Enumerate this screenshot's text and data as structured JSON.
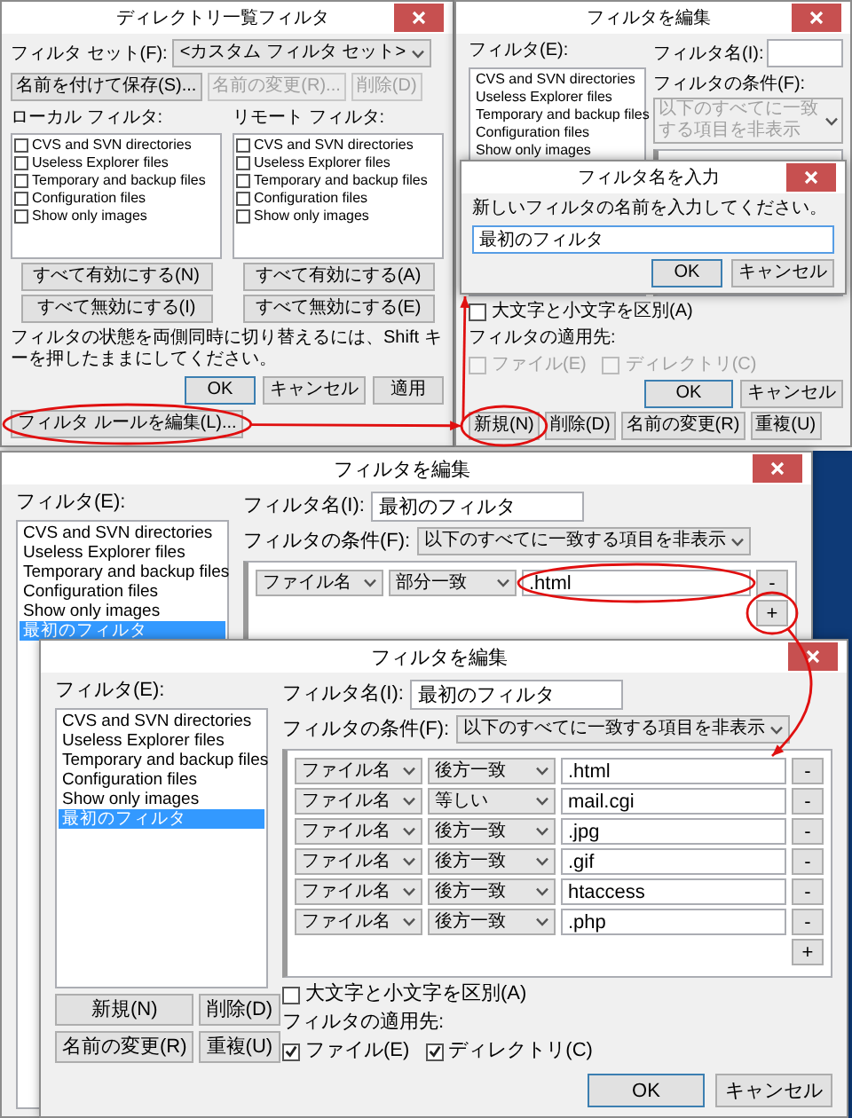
{
  "directory_filter_window": {
    "title": "ディレクトリ一覧フィルタ",
    "filter_set_label": "フィルタ セット(F):",
    "filter_set_value": "<カスタム フィルタ セット>",
    "set_buttons": [
      {
        "label": "名前を付けて保存(S)...",
        "disabled": false
      },
      {
        "label": "名前の変更(R)...",
        "disabled": true
      },
      {
        "label": "削除(D)",
        "disabled": true
      }
    ],
    "panes": [
      {
        "label": "ローカル フィルタ:",
        "items": [
          {
            "label": "CVS and SVN directories",
            "checked": false
          },
          {
            "label": "Useless Explorer files",
            "checked": false
          },
          {
            "label": "Temporary and backup files",
            "checked": false
          },
          {
            "label": "Configuration files",
            "checked": false
          },
          {
            "label": "Show only images",
            "checked": false
          }
        ],
        "buttons": [
          "すべて有効にする(N)",
          "すべて無効にする(I)"
        ]
      },
      {
        "label": "リモート フィルタ:",
        "items": [
          {
            "label": "CVS and SVN directories",
            "checked": false
          },
          {
            "label": "Useless Explorer files",
            "checked": false
          },
          {
            "label": "Temporary and backup files",
            "checked": false
          },
          {
            "label": "Configuration files",
            "checked": false
          },
          {
            "label": "Show only images",
            "checked": false
          }
        ],
        "buttons": [
          "すべて有効にする(A)",
          "すべて無効にする(E)"
        ]
      }
    ],
    "hint": "フィルタの状態を両側同時に切り替えるには、Shift キーを押したままにしてください。",
    "edit_rules_button": "フィルタ ルールを編集(L)...",
    "buttons": [
      "OK",
      "キャンセル",
      "適用"
    ]
  },
  "edit_filter_window_back": {
    "title": "フィルタを編集",
    "filters_label": "フィルタ(E):",
    "filters": [
      {
        "label": "CVS and SVN directories",
        "selected": false
      },
      {
        "label": "Useless Explorer files",
        "selected": false
      },
      {
        "label": "Temporary and backup files",
        "selected": false
      },
      {
        "label": "Configuration files",
        "selected": false
      },
      {
        "label": "Show only images",
        "selected": false
      }
    ],
    "name_label": "フィルタ名(I):",
    "condition_label": "フィルタの条件(F):",
    "condition_value": "以下のすべてに一致する項目を非表示",
    "condition_disabled": true,
    "list_buttons": [
      "新規(N)",
      "削除(D)",
      "名前の変更(R)",
      "重複(U)"
    ],
    "case_label": "大文字と小文字を区別(A)",
    "case_checked": false,
    "apply_label": "フィルタの適用先:",
    "apply_targets": [
      {
        "label": "ファイル(E)",
        "checked": false,
        "disabled": true
      },
      {
        "label": "ディレクトリ(C)",
        "checked": false,
        "disabled": true
      }
    ],
    "buttons": [
      "OK",
      "キャンセル"
    ]
  },
  "name_prompt": {
    "title": "フィルタ名を入力",
    "message": "新しいフィルタの名前を入力してください。",
    "value": "最初のフィルタ",
    "buttons": [
      "OK",
      "キャンセル"
    ]
  },
  "edit_filter_window_middle": {
    "title": "フィルタを編集",
    "filters_label": "フィルタ(E):",
    "filters": [
      {
        "label": "CVS and SVN directories",
        "selected": false
      },
      {
        "label": "Useless Explorer files",
        "selected": false
      },
      {
        "label": "Temporary and backup files",
        "selected": false
      },
      {
        "label": "Configuration files",
        "selected": false
      },
      {
        "label": "Show only images",
        "selected": false
      },
      {
        "label": "最初のフィルタ",
        "selected": true
      }
    ],
    "name_label": "フィルタ名(I):",
    "name_value": "最初のフィルタ",
    "condition_label": "フィルタの条件(F):",
    "condition_value": "以下のすべてに一致する項目を非表示",
    "condition_disabled": false,
    "rules": [
      {
        "field": "ファイル名",
        "match": "部分一致",
        "value": ".html",
        "remove": "-"
      }
    ],
    "add": "+"
  },
  "edit_filter_window_front": {
    "title": "フィルタを編集",
    "filters_label": "フィルタ(E):",
    "filters": [
      {
        "label": "CVS and SVN directories",
        "selected": false
      },
      {
        "label": "Useless Explorer files",
        "selected": false
      },
      {
        "label": "Temporary and backup files",
        "selected": false
      },
      {
        "label": "Configuration files",
        "selected": false
      },
      {
        "label": "Show only images",
        "selected": false
      },
      {
        "label": "最初のフィルタ",
        "selected": true
      }
    ],
    "name_label": "フィルタ名(I):",
    "name_value": "最初のフィルタ",
    "condition_label": "フィルタの条件(F):",
    "condition_value": "以下のすべてに一致する項目を非表示",
    "condition_disabled": false,
    "rules": [
      {
        "field": "ファイル名",
        "match": "後方一致",
        "value": ".html",
        "remove": "-"
      },
      {
        "field": "ファイル名",
        "match": "等しい",
        "value": "mail.cgi",
        "remove": "-"
      },
      {
        "field": "ファイル名",
        "match": "後方一致",
        "value": ".jpg",
        "remove": "-"
      },
      {
        "field": "ファイル名",
        "match": "後方一致",
        "value": ".gif",
        "remove": "-"
      },
      {
        "field": "ファイル名",
        "match": "後方一致",
        "value": "htaccess",
        "remove": "-"
      },
      {
        "field": "ファイル名",
        "match": "後方一致",
        "value": ".php",
        "remove": "-"
      }
    ],
    "add": "+",
    "list_buttons": [
      "新規(N)",
      "削除(D)",
      "名前の変更(R)",
      "重複(U)"
    ],
    "case_label": "大文字と小文字を区別(A)",
    "case_checked": false,
    "apply_label": "フィルタの適用先:",
    "apply_targets": [
      {
        "label": "ファイル(E)",
        "checked": true,
        "disabled": false
      },
      {
        "label": "ディレクトリ(C)",
        "checked": true,
        "disabled": false
      }
    ],
    "buttons": [
      "OK",
      "キャンセル"
    ]
  }
}
